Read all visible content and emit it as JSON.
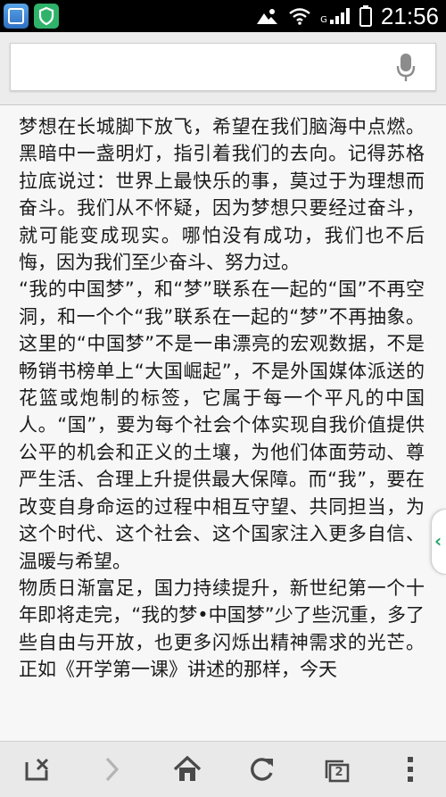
{
  "status_bar": {
    "time": "21:56",
    "network_label": "G",
    "icons": [
      "app-store-icon",
      "security-shield-icon",
      "weather-icon",
      "wifi-icon",
      "cell-signal-icon",
      "battery-icon"
    ]
  },
  "search": {
    "value": "",
    "placeholder": "",
    "mic_icon": "microphone-icon"
  },
  "article": {
    "paragraphs": [
      "梦想在长城脚下放飞，希望在我们脑海中点燃。黑暗中一盏明灯，指引着我们的去向。记得苏格拉底说过：世界上最快乐的事，莫过于为理想而奋斗。我们从不怀疑，因为梦想只要经过奋斗，就可能变成现实。哪怕没有成功，我们也不后悔，因为我们至少奋斗、努力过。",
      "“我的中国梦”，和“梦”联系在一起的“国”不再空洞，和一个个“我”联系在一起的“梦”不再抽象。这里的“中国梦”不是一串漂亮的宏观数据，不是畅销书榜单上“大国崛起”，不是外国媒体派送的花篮或炮制的标签，它属于每一个平凡的中国人。“国”，要为每个社会个体实现自我价值提供公平的机会和正义的土壤，为他们体面劳动、尊严生活、合理上升提供最大保障。而“我”，要在改变自身命运的过程中相互守望、共同担当，为这个时代、这个社会、这个国家注入更多自信、温暖与希望。",
      "物质日渐富足，国力持续提升，新世纪第一个十年即将走完，“我的梦•中国梦”少了些沉重，多了些自由与开放，也更多闪烁出精神需求的光芒。正如《开学第一课》讲述的那样，今天"
    ]
  },
  "bottom_nav": {
    "tab_count": "2",
    "buttons": [
      "close-tab-icon",
      "forward-icon",
      "home-icon",
      "refresh-icon",
      "tabs-icon",
      "menu-icon"
    ]
  },
  "colors": {
    "accent_green": "#25a56a",
    "status_bar_bg": "#000000",
    "nav_icon": "#4a4a4a"
  }
}
